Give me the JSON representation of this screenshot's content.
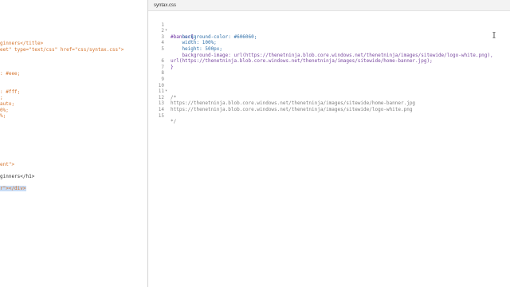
{
  "left_editor": {
    "lines": [
      "ginners</title>",
      "eet\" type=\"text/css\" href=\"css/syntax.css\">",
      "",
      "",
      "",
      ": #eee;",
      "",
      "",
      ": #fff;",
      ";",
      "auto;",
      "0%;",
      "%;",
      "",
      "",
      "",
      "",
      "",
      "",
      "",
      "ent\">",
      "",
      "ginners</h1>",
      "",
      "r\"></div>"
    ]
  },
  "right_editor": {
    "tab_label": "syntax.css",
    "lines": [
      {
        "num": "1",
        "fold": "▾",
        "text": "#banner{"
      },
      {
        "num": "2",
        "fold": "",
        "text": "    background-color: #606060;"
      },
      {
        "num": "3",
        "fold": "",
        "text": "    width: 100%;"
      },
      {
        "num": "4",
        "fold": "",
        "text": "    height: 500px;"
      },
      {
        "num": "5",
        "fold": "",
        "text": "    background-image: url(https://thenetninja.blob.core.windows.net/thenetninja/images/sitewide/logo-white.png),"
      },
      {
        "num": "",
        "fold": "",
        "text": "url(https://thenetninja.blob.core.windows.net/thenetninja/images/sitewide/home-banner.jpg);"
      },
      {
        "num": "6",
        "fold": "",
        "text": "}"
      },
      {
        "num": "7",
        "fold": "",
        "text": ""
      },
      {
        "num": "8",
        "fold": "",
        "text": ""
      },
      {
        "num": "9",
        "fold": "",
        "text": ""
      },
      {
        "num": "10",
        "fold": "▾",
        "text": "/*"
      },
      {
        "num": "11",
        "fold": "",
        "text": ""
      },
      {
        "num": "12",
        "fold": "",
        "text": "https://thenetninja.blob.core.windows.net/thenetninja/images/sitewide/home-banner.jpg"
      },
      {
        "num": "13",
        "fold": "",
        "text": "https://thenetninja.blob.core.windows.net/thenetninja/images/sitewide/logo-white.png"
      },
      {
        "num": "14",
        "fold": "",
        "text": ""
      },
      {
        "num": "15",
        "fold": "",
        "text": "*/"
      }
    ]
  },
  "colors": {
    "selector": "#6b2fa0",
    "property": "#2f6fa8",
    "value": "#d4722a",
    "comment": "#808080"
  }
}
